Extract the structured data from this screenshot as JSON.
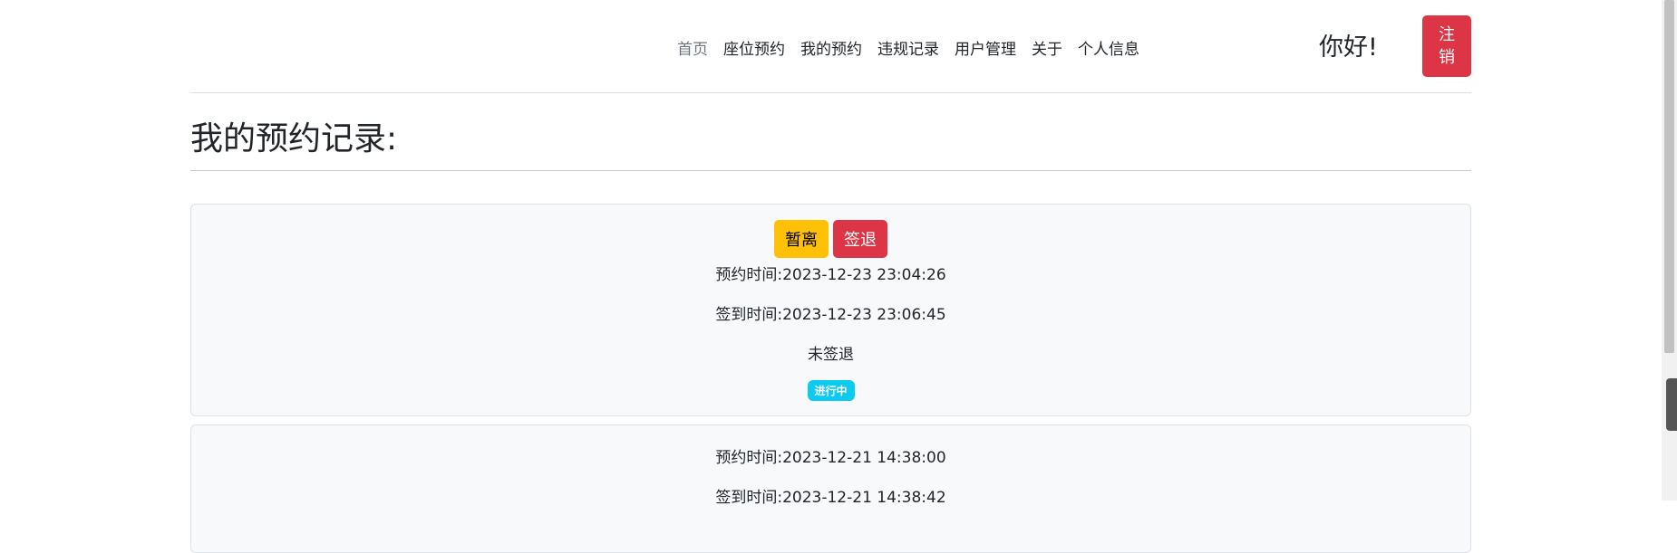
{
  "nav": {
    "items": [
      {
        "label": "首页",
        "active": true
      },
      {
        "label": "座位预约"
      },
      {
        "label": "我的预约"
      },
      {
        "label": "违规记录"
      },
      {
        "label": "用户管理"
      },
      {
        "label": "关于"
      },
      {
        "label": "个人信息"
      }
    ],
    "greeting": "你好!",
    "logout_label": "注销"
  },
  "page": {
    "title": "我的预约记录:"
  },
  "records": [
    {
      "actions": {
        "pause_label": "暂离",
        "checkout_label": "签退"
      },
      "reserve_time": "预约时间:2023-12-23 23:04:26",
      "checkin_time": "签到时间:2023-12-23 23:06:45",
      "checkout_status": "未签退",
      "status_badge": "进行中"
    },
    {
      "reserve_time": "预约时间:2023-12-21 14:38:00",
      "checkin_time": "签到时间:2023-12-21 14:38:42"
    }
  ],
  "colors": {
    "danger": "#dc3545",
    "warning": "#ffc107",
    "info": "#0dcaf0",
    "card_bg": "#f8f9fa"
  }
}
